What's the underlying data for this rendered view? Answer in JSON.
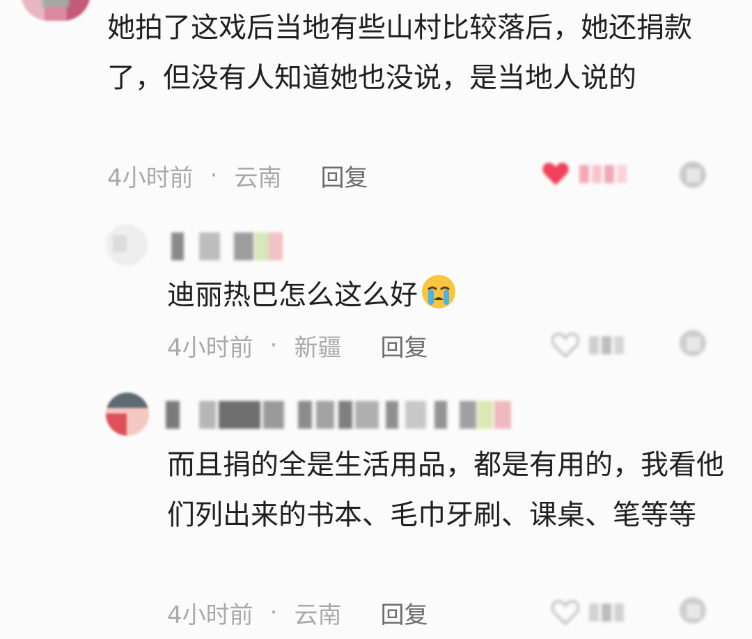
{
  "comments": [
    {
      "text": "她拍了这戏后当地有些山村比较落后，她还捐款了，但没有人知道她也没说，是当地人说的",
      "time": "4小时前",
      "dot": "·",
      "region": "云南",
      "reply_label": "回复"
    },
    {
      "text": "迪丽热巴怎么这么好",
      "emoji": "crying-face",
      "time": "4小时前",
      "dot": "·",
      "region": "新疆",
      "reply_label": "回复"
    },
    {
      "text": "而且捐的全是生活用品，都是有用的，我看他们列出来的书本、毛巾牙刷、课桌、笔等等",
      "time": "4小时前",
      "dot": "·",
      "region": "云南",
      "reply_label": "回复"
    }
  ],
  "icons": {
    "like": "heart-icon",
    "dislike": "dislike-icon"
  },
  "colors": {
    "background": "#fbfbfb",
    "text": "#1f1f1f",
    "meta": "#a9a9a9",
    "reply": "#6b6b6b",
    "liked_heart": "#f0405a",
    "unliked_heart": "#c8c8c8"
  }
}
